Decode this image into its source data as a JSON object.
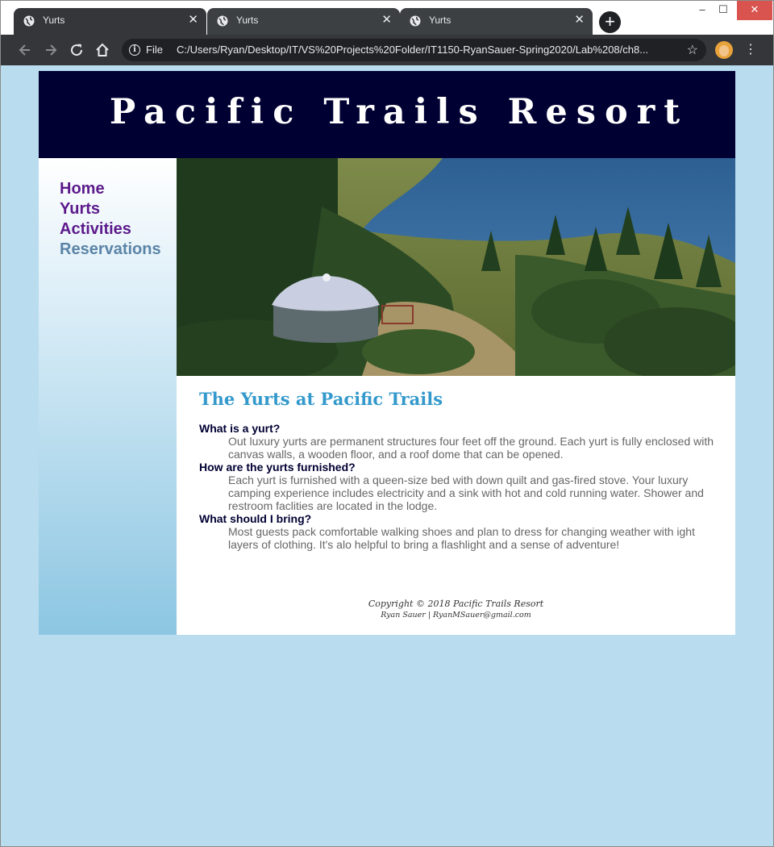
{
  "browser": {
    "tabs": [
      {
        "title": "Yurts",
        "close": "✕"
      },
      {
        "title": "Yurts",
        "close": "✕"
      },
      {
        "title": "Yurts",
        "close": "✕"
      }
    ],
    "new_tab": "+",
    "window_controls": {
      "minimize": "–",
      "maximize": "☐",
      "close": "✕"
    },
    "address": {
      "scheme": "File",
      "url": "C:/Users/Ryan/Desktop/IT/VS%20Projects%20Folder/IT1150-RyanSauer-Spring2020/Lab%208/ch8..."
    },
    "icons": [
      "globe-icon",
      "back-arrow-icon",
      "forward-arrow-icon",
      "reload-icon",
      "home-icon",
      "info-icon",
      "star-icon",
      "profile-avatar",
      "menu-kebab-icon"
    ]
  },
  "site": {
    "title": "Pacific Trails Resort",
    "colors": {
      "header_bg": "#000033",
      "heading": "#3399cc",
      "nav_link": "#5c1a8b",
      "nav_current": "#5a84a7",
      "page_bg": "#b9dcee"
    }
  },
  "nav": [
    {
      "label": "Home"
    },
    {
      "label": "Yurts"
    },
    {
      "label": "Activities"
    },
    {
      "label": "Reservations"
    }
  ],
  "main": {
    "heading": "The Yurts at Pacific Trails",
    "faq": [
      {
        "q": "What is a yurt?",
        "a": "Out luxury yurts are permanent structures four feet off the ground. Each yurt is fully enclosed with canvas walls, a wooden floor, and a roof dome that can be opened."
      },
      {
        "q": "How are the yurts furnished?",
        "a": "Each yurt is furnished with a queen-size bed with down quilt and gas-fired stove. Your luxury camping experience includes electricity and a sink with hot and cold running water. Shower and restroom faclities are located in the lodge."
      },
      {
        "q": "What should I bring?",
        "a": "Most guests pack comfortable walking shoes and plan to dress for changing weather with ight layers of clothing. It's alo helpful to bring a flashlight and a sense of adventure!"
      }
    ]
  },
  "footer": {
    "copyright": "Copyright © 2018 Pacific Trails Resort",
    "author": "Ryan Sauer | RyanMSauer@gmail.com"
  }
}
